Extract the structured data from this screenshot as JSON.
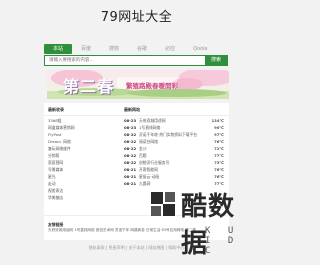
{
  "site_title": "79网址大全",
  "tabs": [
    "本站",
    "百度",
    "搜狗",
    "谷歌",
    "必应",
    "Qoole"
  ],
  "search": {
    "placeholder": "请输入要搜索的内容...",
    "button": "搜索"
  },
  "banner": {
    "big": "第二春",
    "headline": "繁殖路殿春暖開彩"
  },
  "columns": {
    "left_header": "最新收录",
    "right_header": "最新网站"
  },
  "left_items": [
    "3366链",
    "网盒媒体营销网",
    "FlyPost",
    "Dream. 网络",
    "复玩网络维件",
    "分销帮",
    "家庭营网",
    "号景媒体",
    "星光",
    "走动",
    "视差表达",
    "华美基店"
  ],
  "right_items": [
    {
      "date": "08-23",
      "name": "天府双城用途网",
      "count": "134℃"
    },
    {
      "date": "08-23",
      "name": "1号直线网络",
      "count": "90℃"
    },
    {
      "date": "08-22",
      "name": "灵诺千年收·热门实物资料下载平台",
      "count": "97℃"
    },
    {
      "date": "08-22",
      "name": "阅读台网络",
      "count": "76℃"
    },
    {
      "date": "08-22",
      "name": "金沙",
      "count": "72℃"
    },
    {
      "date": "08-22",
      "name": "百题",
      "count": "77℃"
    },
    {
      "date": "08-22",
      "name": "创想灵行业服务号",
      "count": "75℃"
    },
    {
      "date": "08-21",
      "name": "开客智能网",
      "count": "76℃"
    },
    {
      "date": "08-21",
      "name": "星辰云·动画",
      "count": "76℃"
    },
    {
      "date": "08-21",
      "name": "九晨网",
      "count": "77℃"
    }
  ],
  "friend_links": {
    "header": "友情链接",
    "items": [
      "天府双城用途网",
      "1号直线网络",
      "首芭艺术网",
      "灵诺千年",
      "网路新游",
      "日常生活",
      "83号应用网络",
      "第二春"
    ]
  },
  "footer": [
    "隐私条款",
    "免责声明",
    "关于本站",
    "网站地图",
    "帮助中心"
  ],
  "watermark": {
    "text": "酷数据",
    "latin": "K U I D C"
  }
}
